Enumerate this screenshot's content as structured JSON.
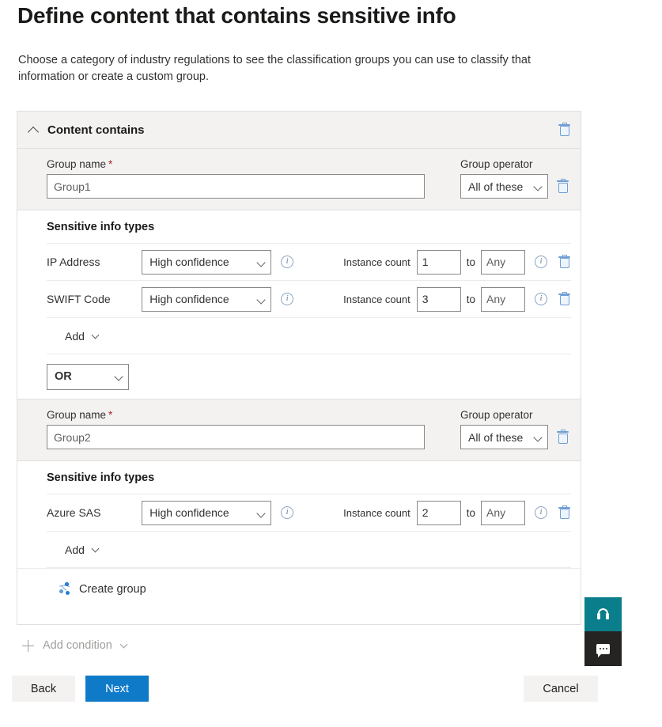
{
  "page": {
    "title": "Define content that contains sensitive info",
    "subtitle": "Choose a category of industry regulations to see the classification groups you can use to classify that information or create a custom group."
  },
  "card": {
    "header_title": "Content contains",
    "collapse_icon": "chevron-up-icon",
    "delete_icon": "trash-icon",
    "sensitive_types_heading": "Sensitive info types",
    "group_name_label": "Group name",
    "group_name_required_marker": "*",
    "group_operator_label": "Group operator",
    "instance_count_label": "Instance count",
    "instance_to_label": "to",
    "add_label": "Add",
    "info_icon_glyph": "i",
    "create_group_label": "Create group",
    "create_group_icon": "group-nodes-icon"
  },
  "groups": [
    {
      "name_value": "Group1",
      "operator_value": "All of these",
      "rows": [
        {
          "type_name": "IP Address",
          "confidence": "High confidence",
          "count_min": "1",
          "count_max": "Any"
        },
        {
          "type_name": "SWIFT Code",
          "confidence": "High confidence",
          "count_min": "3",
          "count_max": "Any"
        }
      ]
    },
    {
      "name_value": "Group2",
      "operator_value": "All of these",
      "rows": [
        {
          "type_name": "Azure SAS",
          "confidence": "High confidence",
          "count_min": "2",
          "count_max": "Any"
        }
      ]
    }
  ],
  "group_join_operator": "OR",
  "add_condition": {
    "label": "Add condition",
    "plus_icon": "plus-icon",
    "chevron_icon": "chevron-down-icon"
  },
  "footer": {
    "back_label": "Back",
    "next_label": "Next",
    "cancel_label": "Cancel"
  },
  "help_widget": {
    "support_icon": "headset-icon",
    "chat_icon": "chat-bubble-icon"
  },
  "colors": {
    "primary_button": "#0f7ac8",
    "support_teal": "#0b7e8c",
    "chat_dark": "#252423",
    "required_red": "#a4262c",
    "trash_blue": "#6f9ed4",
    "band_grey": "#f3f2f1"
  }
}
